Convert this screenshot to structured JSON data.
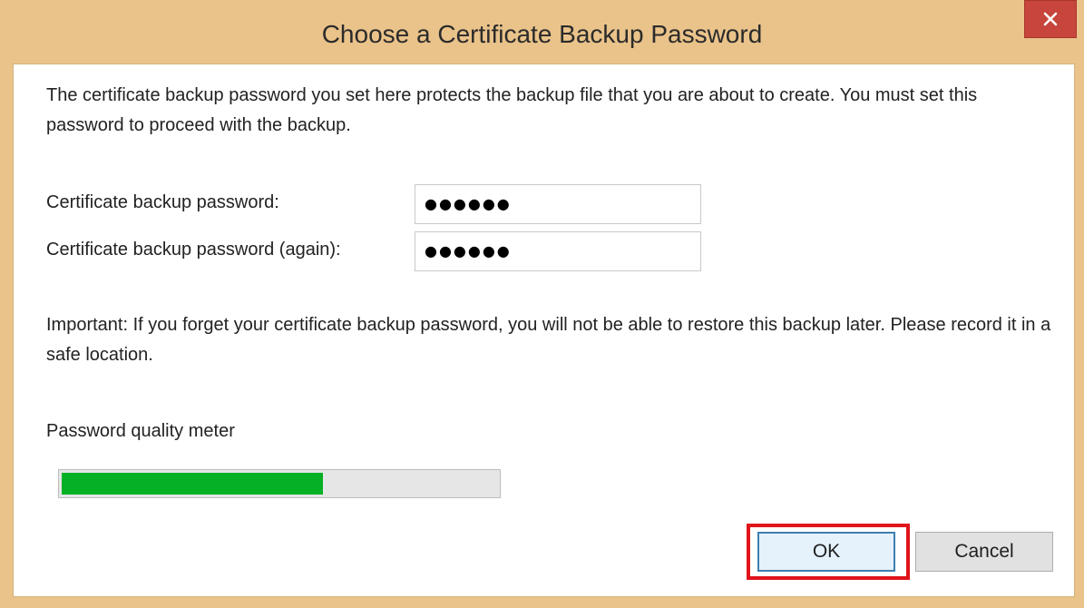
{
  "window": {
    "title": "Choose a Certificate Backup Password",
    "close_icon": "close-icon",
    "frame_color": "#eac38a",
    "close_color": "#c7453c"
  },
  "dialog": {
    "description": "The certificate backup password you set here protects the backup file that you are about to create. You must set this password to proceed with the backup.",
    "password_label": "Certificate backup password:",
    "password_value": "●●●●●●",
    "password_again_label": "Certificate backup password (again):",
    "password_again_value": "●●●●●●",
    "important": "Important: If you forget your certificate backup password, you will not be able to restore this backup later. Please record it in a safe location.",
    "meter_label": "Password quality meter",
    "meter_fraction": 0.6,
    "meter_color": "#06b025"
  },
  "buttons": {
    "ok_label": "OK",
    "cancel_label": "Cancel",
    "highlight_color": "#e0141b"
  }
}
